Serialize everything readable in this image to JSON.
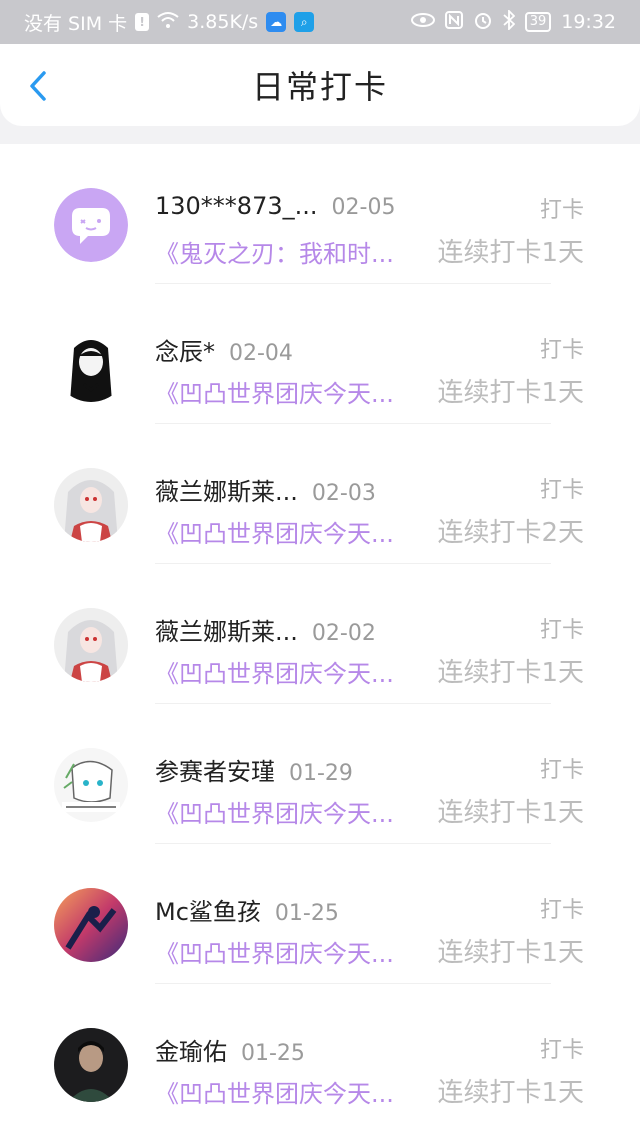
{
  "status_bar": {
    "carrier": "没有 SIM 卡",
    "speed": "3.85K/s",
    "battery": "39",
    "time": "19:32"
  },
  "header": {
    "title": "日常打卡"
  },
  "checkins": [
    {
      "name": "130***873_...",
      "date": "02-05",
      "action": "打卡",
      "topic": "《鬼灭之刃：我和时...",
      "streak": "连续打卡1天",
      "avatar": "purple-bot"
    },
    {
      "name": "念辰*",
      "date": "02-04",
      "action": "打卡",
      "topic": "《凹凸世界团庆今天...",
      "streak": "连续打卡1天",
      "avatar": "girl-dark-hair"
    },
    {
      "name": "薇兰娜斯莱...",
      "date": "02-03",
      "action": "打卡",
      "topic": "《凹凸世界团庆今天...",
      "streak": "连续打卡2天",
      "avatar": "girl-white-hair"
    },
    {
      "name": "薇兰娜斯莱...",
      "date": "02-02",
      "action": "打卡",
      "topic": "《凹凸世界团庆今天...",
      "streak": "连续打卡1天",
      "avatar": "girl-white-hair"
    },
    {
      "name": "参赛者安瑾",
      "date": "01-29",
      "action": "打卡",
      "topic": "《凹凸世界团庆今天...",
      "streak": "连续打卡1天",
      "avatar": "sketch-character"
    },
    {
      "name": "Mc鲨鱼孩",
      "date": "01-25",
      "action": "打卡",
      "topic": "《凹凸世界团庆今天...",
      "streak": "连续打卡1天",
      "avatar": "colorful-art"
    },
    {
      "name": "金瑜佑",
      "date": "01-25",
      "action": "打卡",
      "topic": "《凹凸世界团庆今天...",
      "streak": "连续打卡1天",
      "avatar": "dark-portrait"
    }
  ]
}
